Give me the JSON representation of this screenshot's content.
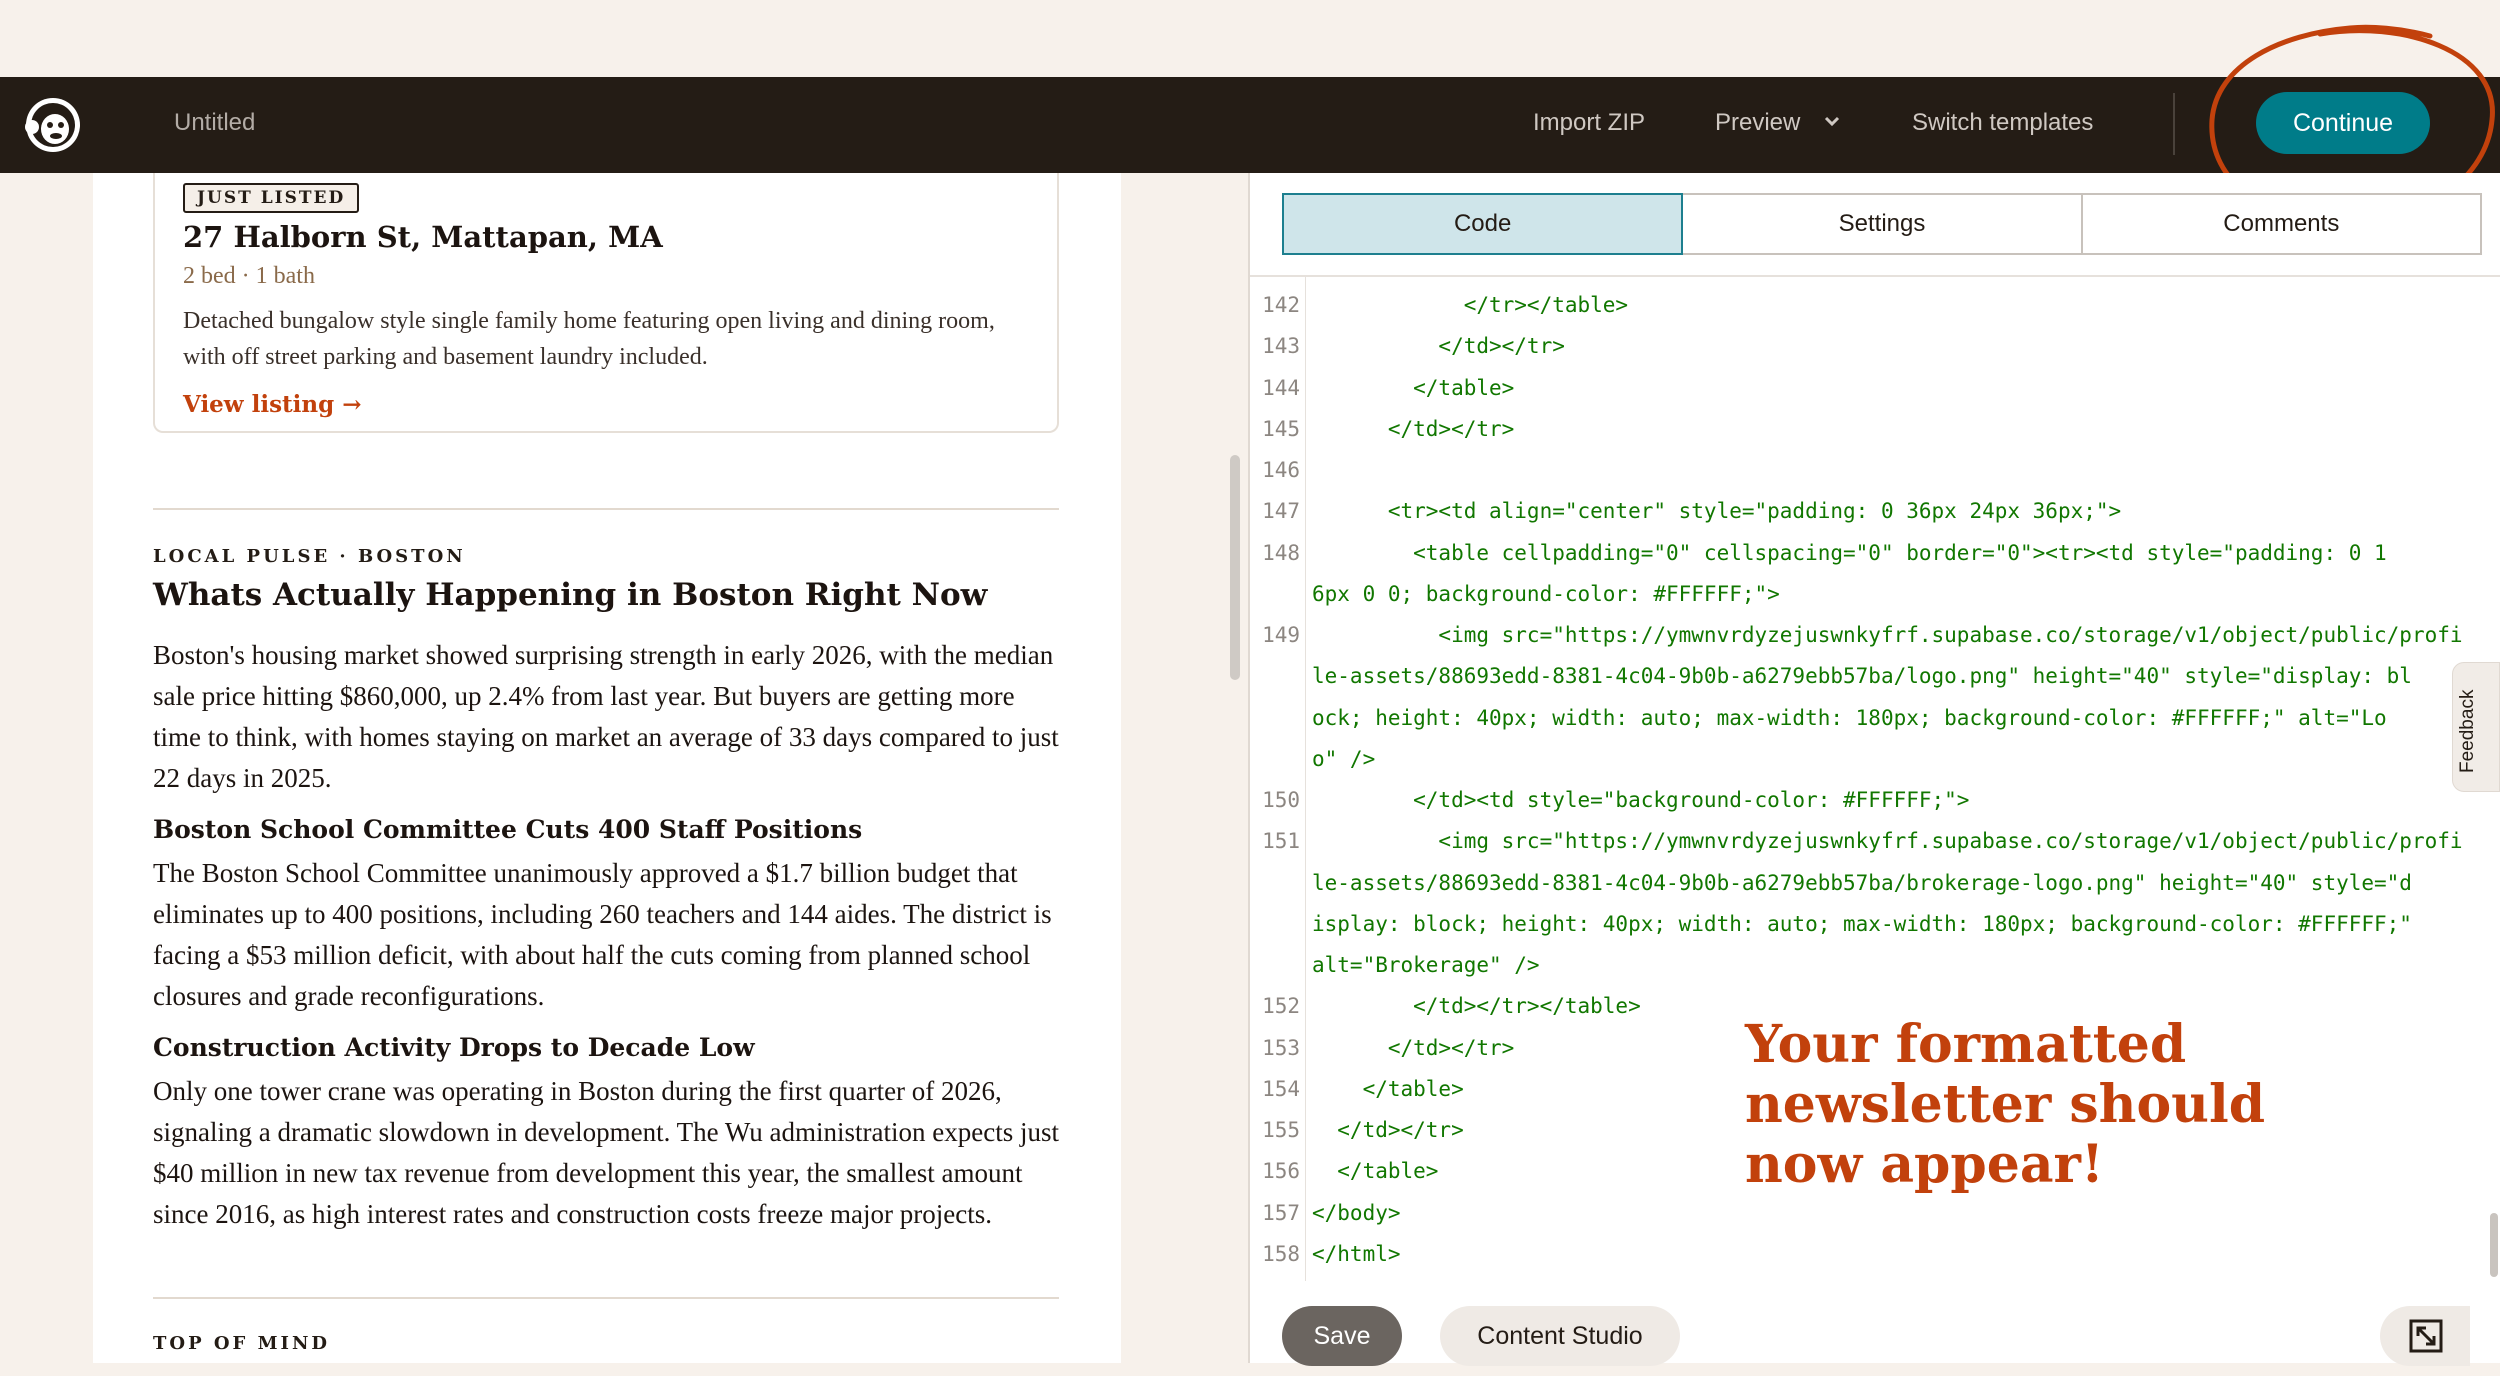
{
  "header": {
    "doc_title": "Untitled",
    "import_zip": "Import ZIP",
    "preview": "Preview",
    "switch_templates": "Switch templates",
    "continue": "Continue"
  },
  "listing": {
    "badge": "JUST LISTED",
    "address": "27 Halborn St, Mattapan, MA",
    "meta": "2 bed · 1 bath",
    "description": "Detached bungalow style single family home featuring open living and dining room, with off street parking and basement laundry included.",
    "link": "View listing →"
  },
  "local_pulse": {
    "kicker": "LOCAL PULSE · BOSTON",
    "headline": "Whats Actually Happening in Boston Right Now",
    "paragraph": "Boston's housing market showed surprising strength in early 2026, with the median sale price hitting $860,000, up 2.4% from last year. But buyers are getting more time to think, with homes staying on market an average of 33 days compared to just 22 days in 2025.",
    "subhead_1": "Boston School Committee Cuts 400 Staff Positions",
    "paragraph_1": "The Boston School Committee unanimously approved a $1.7 billion budget that eliminates up to 400 positions, including 260 teachers and 144 aides. The district is facing a $53 million deficit, with about half the cuts coming from planned school closures and grade reconfigurations.",
    "subhead_2": "Construction Activity Drops to Decade Low",
    "paragraph_2": "Only one tower crane was operating in Boston during the first quarter of 2026, signaling a dramatic slowdown in development. The Wu administration expects just $40 million in new tax revenue from development this year, the smallest amount since 2016, as high interest rates and construction costs freeze major projects."
  },
  "top_of_mind": {
    "kicker": "TOP OF MIND"
  },
  "editor": {
    "tabs": [
      "Code",
      "Settings",
      "Comments"
    ],
    "active_tab": "Code",
    "line_numbers": [
      "142",
      "143",
      "144",
      "145",
      "146",
      "147",
      "148",
      "",
      "149",
      "",
      "",
      "",
      "150",
      "151",
      "",
      "",
      "",
      "152",
      "153",
      "154",
      "155",
      "156",
      "157",
      "158"
    ],
    "lines": [
      "            </tr></table>",
      "          </td></tr>",
      "        </table>",
      "      </td></tr>",
      "",
      "      <tr><td align=\"center\" style=\"padding: 0 36px 24px 36px;\">",
      "        <table cellpadding=\"0\" cellspacing=\"0\" border=\"0\"><tr><td style=\"padding: 0 1",
      "6px 0 0; background-color: #FFFFFF;\">",
      "          <img src=\"https://ymwnvrdyzejuswnkyfrf.supabase.co/storage/v1/object/public/profi",
      "le-assets/88693edd-8381-4c04-9b0b-a6279ebb57ba/logo.png\" height=\"40\" style=\"display: bl",
      "ock; height: 40px; width: auto; max-width: 180px; background-color: #FFFFFF;\" alt=\"Lo",
      "o\" />",
      "        </td><td style=\"background-color: #FFFFFF;\">",
      "          <img src=\"https://ymwnvrdyzejuswnkyfrf.supabase.co/storage/v1/object/public/profi",
      "le-assets/88693edd-8381-4c04-9b0b-a6279ebb57ba/brokerage-logo.png\" height=\"40\" style=\"d",
      "isplay: block; height: 40px; width: auto; max-width: 180px; background-color: #FFFFFF;\"",
      "alt=\"Brokerage\" />",
      "        </td></tr></table>",
      "      </td></tr>",
      "    </table>",
      "  </td></tr>",
      "  </table>",
      "</body>",
      "</html>"
    ]
  },
  "annotation": "Your formatted\nnewsletter should\nnow appear!",
  "feedback": "Feedback",
  "bottom": {
    "save": "Save",
    "content_studio": "Content Studio"
  },
  "colors": {
    "accent": "#007c89",
    "annotation": "#c2410c",
    "topbar": "#241c15"
  }
}
